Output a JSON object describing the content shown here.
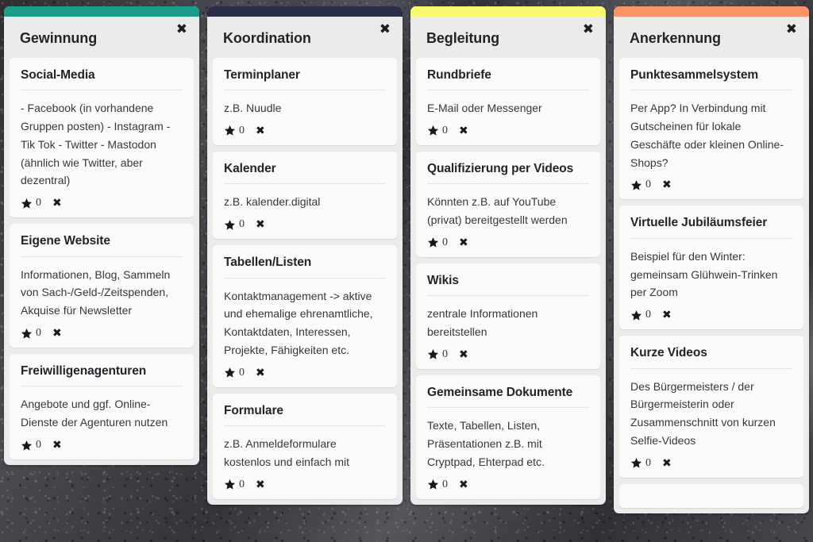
{
  "board": {
    "background": "#3b3b40",
    "icons": {
      "column_close": "close-icon",
      "card_delete": "close-icon",
      "vote": "star-icon"
    }
  },
  "columns": [
    {
      "title": "Gewinnung",
      "accent_color": "#1b9c8b",
      "close_label": "✖",
      "cards": [
        {
          "title": "Social-Media",
          "body": "- Facebook (in vorhandene Gruppen posten) - Instagram - Tik Tok - Twitter - Mastodon (ähnlich wie Twitter, aber dezentral)",
          "votes": "0",
          "delete_label": "✖"
        },
        {
          "title": "Eigene Website",
          "body": "Informationen, Blog, Sammeln von Sach-/Geld-/Zeitspenden, Akquise für Newsletter",
          "votes": "0",
          "delete_label": "✖"
        },
        {
          "title": "Freiwilligenagenturen",
          "body": "Angebote und ggf. Online-Dienste der Agenturen nutzen",
          "votes": "0",
          "delete_label": "✖"
        }
      ]
    },
    {
      "title": "Koordination",
      "accent_color": "#2a2e49",
      "close_label": "✖",
      "cards": [
        {
          "title": "Terminplaner",
          "body": "z.B. Nuudle",
          "votes": "0",
          "delete_label": "✖"
        },
        {
          "title": "Kalender",
          "body": "z.B. kalender.digital",
          "votes": "0",
          "delete_label": "✖"
        },
        {
          "title": "Tabellen/Listen",
          "body": "Kontaktmanagement -> aktive und ehemalige ehrenamtliche, Kontaktdaten, Interessen, Projekte, Fähigkeiten etc.",
          "votes": "0",
          "delete_label": "✖"
        },
        {
          "title": "Formulare",
          "body": "z.B. Anmeldeformulare kostenlos und einfach mit",
          "votes": "0",
          "delete_label": "✖"
        }
      ]
    },
    {
      "title": "Begleitung",
      "accent_color": "#f9f871",
      "close_label": "✖",
      "cards": [
        {
          "title": "Rundbriefe",
          "body": "E-Mail oder Messenger",
          "votes": "0",
          "delete_label": "✖"
        },
        {
          "title": "Qualifizierung per Videos",
          "body": "Könnten z.B. auf YouTube (privat) bereitgestellt werden",
          "votes": "0",
          "delete_label": "✖"
        },
        {
          "title": "Wikis",
          "body": "zentrale Informationen bereitstellen",
          "votes": "0",
          "delete_label": "✖"
        },
        {
          "title": "Gemeinsame Dokumente",
          "body": "Texte, Tabellen, Listen, Präsentationen z.B. mit Cryptpad, Ehterpad etc.",
          "votes": "0",
          "delete_label": "✖"
        }
      ]
    },
    {
      "title": "Anerkennung",
      "accent_color": "#fb9268",
      "close_label": "✖",
      "cards": [
        {
          "title": "Punktesammelsystem",
          "body": "Per App? In Verbindung mit Gutscheinen für lokale Geschäfte oder kleinen Online-Shops?",
          "votes": "0",
          "delete_label": "✖"
        },
        {
          "title": "Virtuelle Jubiläumsfeier",
          "body": "Beispiel für den Winter: gemeinsam Glühwein-Trinken per Zoom",
          "votes": "0",
          "delete_label": "✖"
        },
        {
          "title": "Kurze Videos",
          "body": "Des Bürgermeisters / der Bürgermeisterin oder Zusammenschnitt von kurzen Selfie-Videos",
          "votes": "0",
          "delete_label": "✖"
        },
        {
          "title": "",
          "body": "",
          "votes": "",
          "delete_label": ""
        }
      ]
    },
    {
      "title": "",
      "accent_color": "#e8e8e8",
      "close_label": "",
      "cards": []
    }
  ]
}
